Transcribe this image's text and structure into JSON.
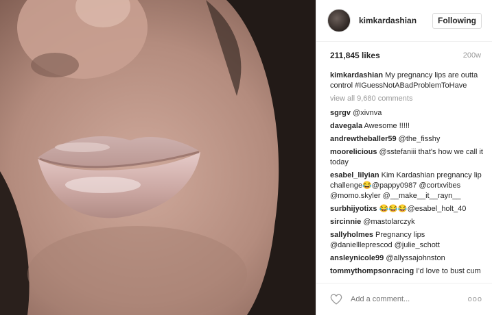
{
  "post": {
    "username": "kimkardashian",
    "follow_label": "Following",
    "likes": "211,845 likes",
    "age": "200w",
    "caption": {
      "user": "kimkardashian",
      "text": "My pregnancy lips are outta control #IGuessNotABadProblemToHave"
    },
    "view_all": "view all 9,680 comments",
    "comments": [
      {
        "user": "sgrgv",
        "text": "@xivnva"
      },
      {
        "user": "davegala",
        "text": "Awesome !!!!!"
      },
      {
        "user": "andrewtheballer59",
        "text": "@the_fisshy"
      },
      {
        "user": "moorelicious",
        "text": "@sstefaniii that's how we call it today"
      },
      {
        "user": "esabel_lilyian",
        "text": "Kim Kardashian pregnancy lip challenge😂@pappy0987 @cortxvibes @momo.skyler @__make__it__rayn__"
      },
      {
        "user": "surbhijyotixs",
        "text": "😂😂😂@esabel_holt_40"
      },
      {
        "user": "sircinnie",
        "text": "@mastolarczyk"
      },
      {
        "user": "sallyholmes",
        "text": "Pregnancy lips @daniellleprescod @julie_schott"
      },
      {
        "user": "ansleynicole99",
        "text": "@allyssajohnston"
      },
      {
        "user": "tommythompsonracing",
        "text": "I'd love to bust cum all on them lips"
      }
    ],
    "add_comment_placeholder": "Add a comment...",
    "more_label": "ooo"
  },
  "icons": {
    "like": "heart-icon",
    "more": "more-options-icon"
  },
  "colors": {
    "text": "#262626",
    "muted": "#999999",
    "border": "#dbdbdb"
  }
}
